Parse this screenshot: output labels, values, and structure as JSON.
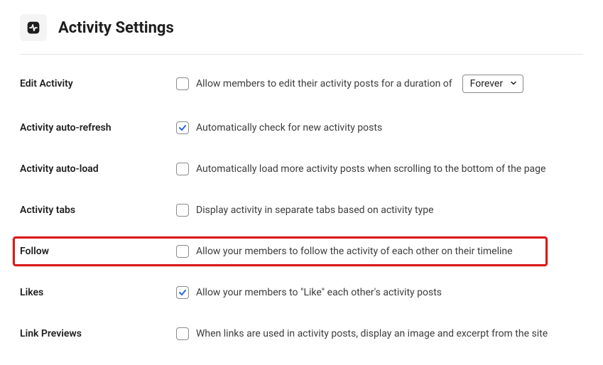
{
  "header": {
    "title": "Activity Settings",
    "icon_name": "activity-icon"
  },
  "settings": {
    "edit_activity": {
      "label": "Edit Activity",
      "text_before": "Allow members to edit their activity posts for a duration of",
      "checked": false,
      "select_value": "Forever"
    },
    "auto_refresh": {
      "label": "Activity auto-refresh",
      "text": "Automatically check for new activity posts",
      "checked": true
    },
    "auto_load": {
      "label": "Activity auto-load",
      "text": "Automatically load more activity posts when scrolling to the bottom of the page",
      "checked": false
    },
    "tabs": {
      "label": "Activity tabs",
      "text": "Display activity in separate tabs based on activity type",
      "checked": false
    },
    "follow": {
      "label": "Follow",
      "text": "Allow your members to follow the activity of each other on their timeline",
      "checked": false,
      "highlighted": true
    },
    "likes": {
      "label": "Likes",
      "text": "Allow your members to \"Like\" each other's activity posts",
      "checked": true
    },
    "link_previews": {
      "label": "Link Previews",
      "text": "When links are used in activity posts, display an image and excerpt from the site",
      "checked": false
    }
  }
}
